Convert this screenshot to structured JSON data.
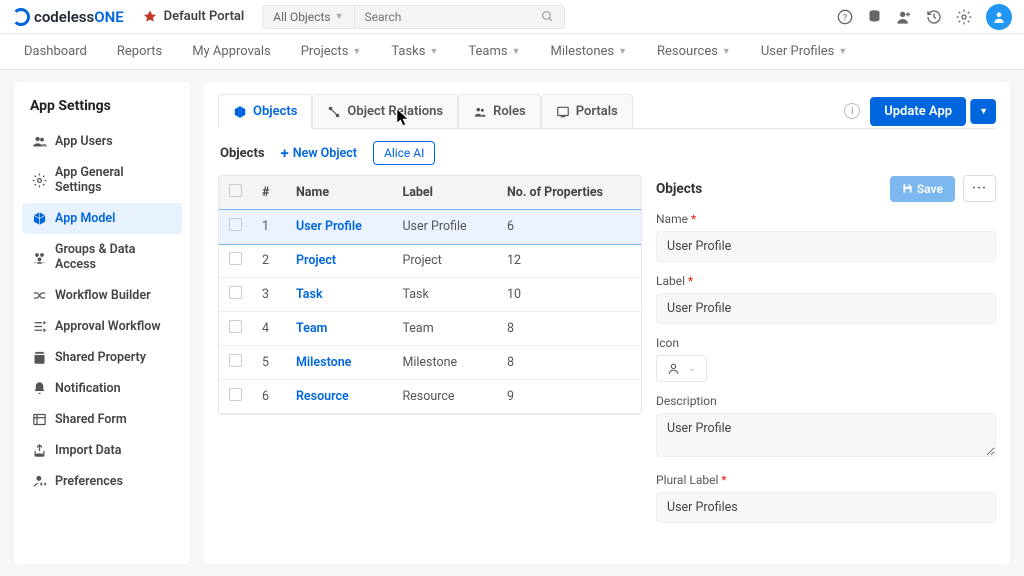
{
  "top": {
    "logo_left": "codeless",
    "logo_right": "ONE",
    "portal": "Default Portal",
    "all_objects": "All Objects",
    "search_ph": "Search"
  },
  "nav": [
    "Dashboard",
    "Reports",
    "My Approvals",
    "Projects",
    "Tasks",
    "Teams",
    "Milestones",
    "Resources",
    "User Profiles"
  ],
  "nav_dd": [
    false,
    false,
    false,
    true,
    true,
    true,
    true,
    true,
    true
  ],
  "sidebar": {
    "title": "App Settings",
    "items": [
      "App Users",
      "App General Settings",
      "App Model",
      "Groups & Data Access",
      "Workflow Builder",
      "Approval Workflow",
      "Shared Property",
      "Notification",
      "Shared Form",
      "Import Data",
      "Preferences"
    ],
    "active": 2
  },
  "tabs": {
    "items": [
      "Objects",
      "Object Relations",
      "Roles",
      "Portals"
    ],
    "active": 0,
    "update": "Update App"
  },
  "sub": {
    "label": "Objects",
    "new": "New Object",
    "alice": "Alice AI"
  },
  "table": {
    "headers": [
      "#",
      "Name",
      "Label",
      "No. of Properties"
    ],
    "rows": [
      {
        "n": "1",
        "name": "User Profile",
        "label": "User Profile",
        "props": "6",
        "sel": true
      },
      {
        "n": "2",
        "name": "Project",
        "label": "Project",
        "props": "12"
      },
      {
        "n": "3",
        "name": "Task",
        "label": "Task",
        "props": "10"
      },
      {
        "n": "4",
        "name": "Team",
        "label": "Team",
        "props": "8"
      },
      {
        "n": "5",
        "name": "Milestone",
        "label": "Milestone",
        "props": "8"
      },
      {
        "n": "6",
        "name": "Resource",
        "label": "Resource",
        "props": "9"
      }
    ]
  },
  "detail": {
    "title": "Objects",
    "save": "Save",
    "fields": {
      "name_lbl": "Name",
      "name_val": "User Profile",
      "label_lbl": "Label",
      "label_val": "User Profile",
      "icon_lbl": "Icon",
      "desc_lbl": "Description",
      "desc_val": "User Profile",
      "plural_lbl": "Plural Label",
      "plural_val": "User Profiles"
    }
  }
}
